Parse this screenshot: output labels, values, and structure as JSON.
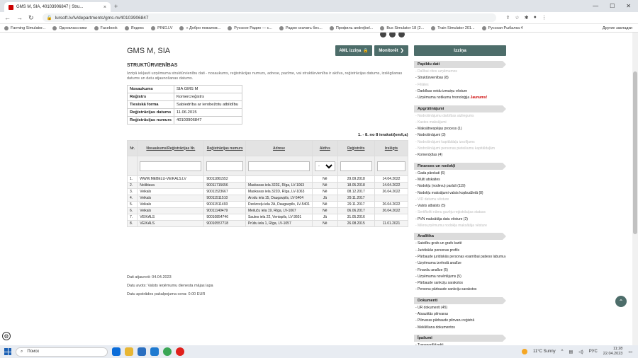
{
  "browser": {
    "tab_title": "GMS M, SIA, 40103906847 | Stru...",
    "url": "lursoft.lv/lv/departments/gms-m/40103906847",
    "bookmarks": [
      "Farming Simulator...",
      "Одноклассники",
      "Facebook",
      "Яндекс",
      "PING.LV",
      "« Добро пожалов...",
      "Русское Радио — с...",
      "Радио скачать бес...",
      "Профиль andrejbel...",
      "Bus Simulator 18 (2...",
      "Train Simulator 201...",
      "Русская Рыбалка 4"
    ],
    "bookmarks_right": "Другие закладки"
  },
  "page": {
    "title": "GMS M, SIA",
    "aml_button": "AML izziņa",
    "monitor_button": "Monitorēt",
    "izzina_button": "Izziņa",
    "section_title": "STRUKTŪRVIENĪBAS",
    "description": "Izziņā iekļauti uzņēmuma struktūrvienību dati - nosaukums, reģistrācijas numurs, adrese, pazīme, vai struktūrvienība ir aktīva, reģistrācijas datums, izslēgšanas datums un datu atjaunošanas datums.",
    "info": [
      {
        "k": "Nosaukums",
        "v": "SIA GMS M"
      },
      {
        "k": "Reģistrs",
        "v": "Komercreģistrs"
      },
      {
        "k": "Tiesiskā forma",
        "v": "Sabiedrība ar ierobežotu atbildību"
      },
      {
        "k": "Reģistrācijas datums",
        "v": "11.06.2015"
      },
      {
        "k": "Reģistrācijas numurs",
        "v": "40103906847"
      }
    ],
    "count": "1. - 8. no 8 ieraksti(em/i,a)",
    "columns": [
      "Nr.",
      "Nosaukums/Reģistrācijas Nr.",
      "Reģistrācijas numurs",
      "Adrese",
      "Aktīvs",
      "Reģistrēts",
      "Izslēgts"
    ],
    "filter_select": "-",
    "rows": [
      [
        "1.",
        "WWW.MEBELU-VEIKALS.LV",
        "90011861552",
        "",
        "Nē",
        "29.09.2018",
        "14.04.2022"
      ],
      [
        "2.",
        "Noliktava",
        "90011715656",
        "Maskavas iela 322E, Rīga, LV-1063",
        "Nē",
        "18.05.2018",
        "14.04.2022"
      ],
      [
        "3.",
        "Veikals",
        "90011523667",
        "Maskavas iela 322D, Rīga, LV-1063",
        "Nē",
        "08.12.2017",
        "26.04.2022"
      ],
      [
        "4.",
        "Veikals",
        "90011511510",
        "Arodu iela 15, Daugavpils, LV-5404",
        "Jā",
        "29.11.2017",
        ""
      ],
      [
        "5.",
        "Veikals",
        "90011511493",
        "Dzelzceļu iela 2A, Daugavpils, LV-5401",
        "Nē",
        "29.11.2017",
        "26.04.2022"
      ],
      [
        "6.",
        "Veikals",
        "90011149479",
        "Meiluču iela 19, Rīga, LV-1067",
        "Nē",
        "06.06.2017",
        "26.04.2022"
      ],
      [
        "7.",
        "VEIKALS",
        "90010854746",
        "Saules iela 22, Ventspils, LV-3601",
        "Jā",
        "31.05.2016",
        ""
      ],
      [
        "8.",
        "VEIKALS",
        "90010557718",
        "Prūšu iela 1, Rīga, LV-1057",
        "Nē",
        "26.08.2015",
        "11.01.2021"
      ]
    ],
    "updated": "Dati atjaunoti: 04.04.2023",
    "source": "Datu avots: Valsts ieņēmumu dienesta mājas lapa",
    "price": "Datu apstrādes pakalpojuma cena: 0.00 EUR"
  },
  "sidebar": {
    "sections": [
      {
        "title": "Papildu dati",
        "items": [
          {
            "t": "- Dalībai citos uzņēmumos",
            "d": true
          },
          {
            "t": "- Struktūrvienības (8)",
            "d": false
          },
          {
            "t": "- Filiāles",
            "d": true
          },
          {
            "t": "- Darbības veidu izmaiņu vēsture",
            "d": false
          },
          {
            "t": "- Uzņēmuma notikumu hronoloģija",
            "d": false,
            "new": "Jaunums!"
          }
        ]
      },
      {
        "title": "Apgrūtinājumi",
        "items": [
          {
            "t": "- Nodrošinājumu darbības aizliegums",
            "d": true
          },
          {
            "t": "- Kastes maksājumi",
            "d": true
          },
          {
            "t": "- Maksātnespējas process (1)",
            "d": false
          },
          {
            "t": "- Nodrošinājumi (3)",
            "d": false
          },
          {
            "t": "- Nodrošinājumi kapitāldaļu izsolījums",
            "d": true
          },
          {
            "t": "- Nodrošinājumi personas pieteikumu kapitāldaļām",
            "d": true
          },
          {
            "t": "- Komercķīlas (4)",
            "d": false
          }
        ]
      },
      {
        "title": "Finanses un nodokļi",
        "items": [
          {
            "t": "- Gada pārskati (6)",
            "d": false
          },
          {
            "t": "- Multi atskaites",
            "d": false
          },
          {
            "t": "- Nodokļu (nodevu) parādi (119)",
            "d": false
          },
          {
            "t": "- Nodokļu maksājumi valsts kopbudžetā (8)",
            "d": false
          },
          {
            "t": "- VID datumu vēsture",
            "d": true
          },
          {
            "t": "- Valsts atbalsts (5)",
            "d": false
          },
          {
            "t": "- Sertificēti nāmu guvēju reģistrācijas statuss",
            "d": true
          },
          {
            "t": "- PVN maksātāja datu vēsture (2)",
            "d": false
          },
          {
            "t": "- Mikrouzņēmumu nodokļa maksātāja vēsture",
            "d": true
          }
        ]
      },
      {
        "title": "Analītika",
        "items": [
          {
            "t": "- Saistību grafs un grafs kartē",
            "d": false
          },
          {
            "t": "- Juridiskās personas profils",
            "d": false
          },
          {
            "t": "- Pārbaude juridiskās personas esamībai patieso labumu guvēju kontroles kēdē",
            "d": false
          },
          {
            "t": "- Uzņēmuma izvērstā analīze",
            "d": false
          },
          {
            "t": "- Finanšu analīze (5)",
            "d": false
          },
          {
            "t": "- Uzņēmuma novērtējums (5)",
            "d": false
          },
          {
            "t": "- Pārbaude sankciju sarakstos",
            "d": false
          },
          {
            "t": "- Personu pārbaude sankciju sarakstos",
            "d": false
          }
        ]
      },
      {
        "title": "Dokumenti",
        "items": [
          {
            "t": "- UR dokumenti (45)",
            "d": false
          },
          {
            "t": "- Atsauktās pilnvaras",
            "d": false
          },
          {
            "t": "- Pilnvaras pārbaude pilnvaru reģistrā",
            "d": false
          },
          {
            "t": "- Meklēšana dokumentos",
            "d": false
          }
        ]
      },
      {
        "title": "Īpašumi",
        "items": [
          {
            "t": "- Transportlīdzekļi",
            "d": false
          }
        ]
      }
    ]
  },
  "taskbar": {
    "search": "Поиск",
    "weather": "11°C Sunny",
    "lang": "РУС",
    "time": "11:28",
    "date": "22.04.2023"
  }
}
